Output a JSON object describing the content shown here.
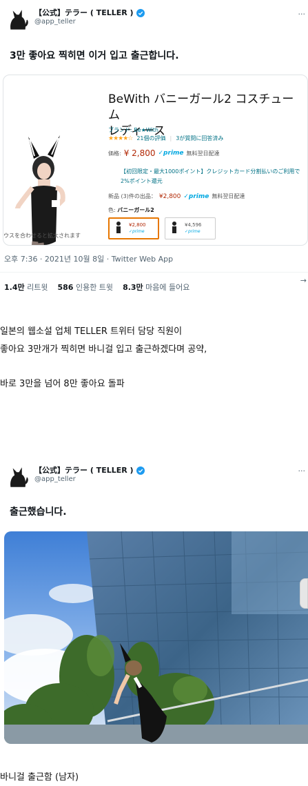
{
  "tweet1": {
    "display_name": "【公式】テラー ( TELLER )",
    "handle": "@app_teller",
    "text": "3만 좋아요 찍히면 이거 입고 출근합니다.",
    "product": {
      "title_line1": "BeWith バニーガール2 コスチューム",
      "title_line2": "レディース",
      "brand": "ブランド: Be★With",
      "stars": "★★★★☆",
      "rating_count": "21個の評価",
      "qa": "3が質問に回答済み",
      "price_label": "価格:",
      "price": "¥ 2,800",
      "prime": "✓prime",
      "delivery": "無料翌日配達",
      "promo": "【初回限定・最大1000ポイント】クレジットカード分割払いのご利用で2%ポイント還元",
      "new_label": "新品 (3)件の出品：",
      "new_price": "¥2,800",
      "new_delivery": "無料翌日配達",
      "color_label": "色:",
      "color_value": "バニーガール2",
      "swatch1_price": "¥2,800",
      "swatch1_prime": "✓prime",
      "swatch2_price": "¥4,596",
      "swatch2_prime": "✓prime",
      "image_caption": "ウスを合わせると拡大されます"
    },
    "meta": "오후 7:36 · 2021년 10월 8일 · Twitter Web App",
    "retweets_count": "1.4만",
    "retweets_label": "리트윗",
    "quotes_count": "586",
    "quotes_label": "인용한 트윗",
    "likes_count": "8.3만",
    "likes_label": "마음에 들어요"
  },
  "body": {
    "line1": "일본의 웹소설 업체 TELLER 트위터 담당 직원이",
    "line2": "좋아요 3만개가 찍히면 바니걸 입고 출근하겠다며 공약,",
    "line3": "바로 3만을 넘어 8만 좋아요 돌파",
    "caption": "바니걸 출근함 (남자)"
  },
  "tweet2": {
    "display_name": "【公式】テラー ( TELLER )",
    "handle": "@app_teller",
    "text": "출근했습니다."
  },
  "icons": {
    "more": "···",
    "share_stub": "→"
  },
  "colors": {
    "verified": "#1d9bf0",
    "muted": "#536471",
    "price": "#b12704",
    "prime": "#00a8e1"
  }
}
